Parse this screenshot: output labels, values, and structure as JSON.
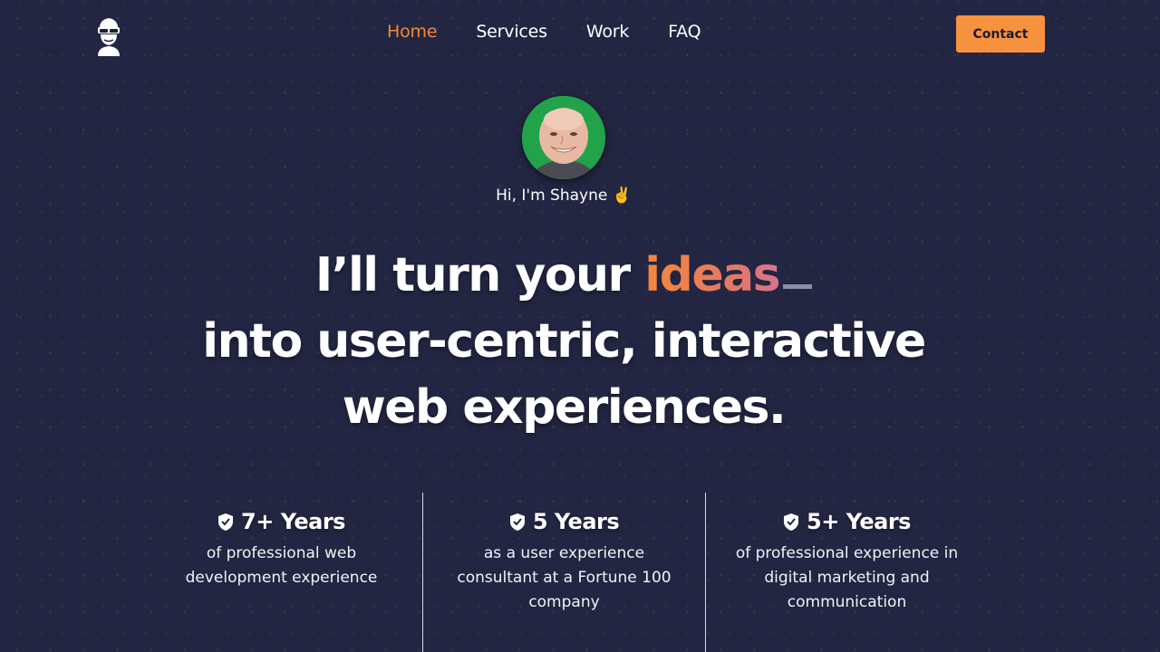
{
  "header": {
    "logo_icon": "ninja-logo-icon",
    "nav": [
      {
        "label": "Home",
        "active": true
      },
      {
        "label": "Services",
        "active": false
      },
      {
        "label": "Work",
        "active": false
      },
      {
        "label": "FAQ",
        "active": false
      }
    ],
    "contact_label": "Contact",
    "accent_color": "#f6913d"
  },
  "hero": {
    "greeting": "Hi, I'm Shayne ✌️",
    "headline_part1": "I’ll turn your",
    "headline_accent": "ideas",
    "headline_line2": "into user-centric, interactive",
    "headline_line3": "web experiences."
  },
  "stats": [
    {
      "icon": "shield-check-icon",
      "title": "7+ Years",
      "description": "of professional web development experience"
    },
    {
      "icon": "shield-check-icon",
      "title": "5 Years",
      "description": "as a user experience consultant at a Fortune 100 company"
    },
    {
      "icon": "shield-check-icon",
      "title": "5+ Years",
      "description": "of professional experience in digital marketing and communication"
    }
  ],
  "colors": {
    "background": "#232642",
    "accent_orange": "#f6913d",
    "accent_pink": "#d7738c"
  }
}
